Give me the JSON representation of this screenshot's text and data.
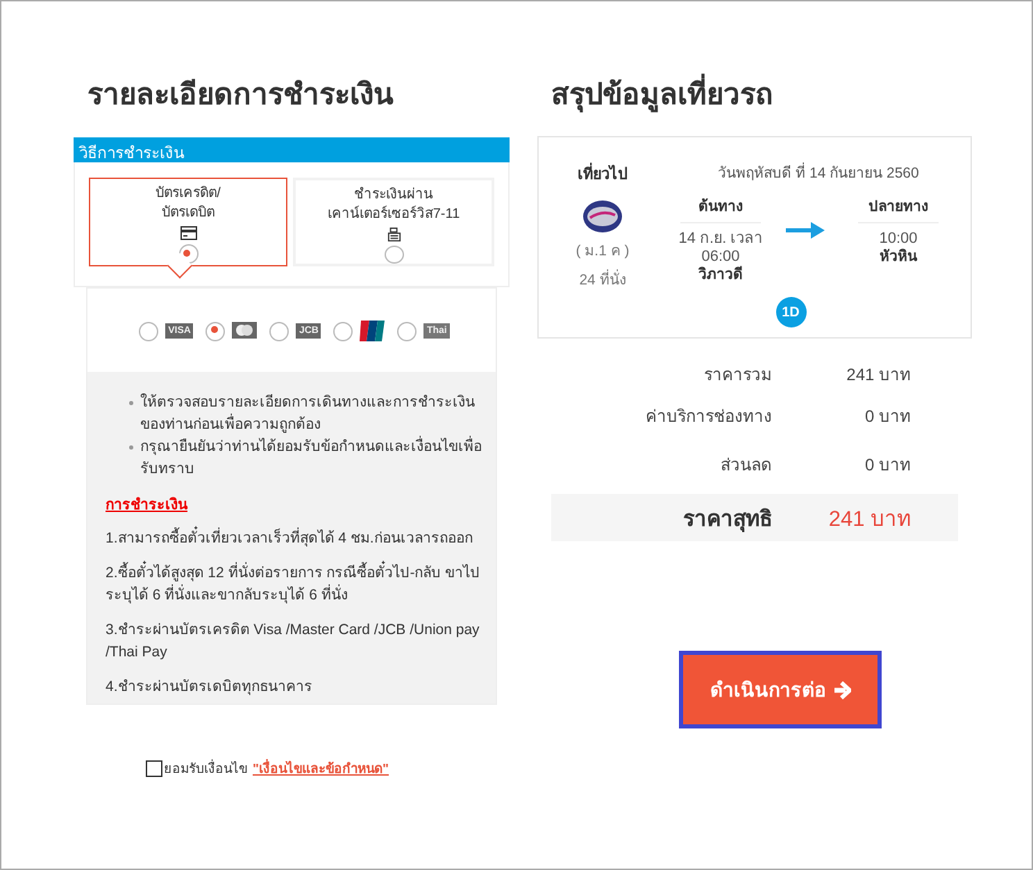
{
  "payment": {
    "title": "รายละเอียดการชำระเงิน",
    "section_title": "วิธีการชำระเงิน",
    "methods": [
      {
        "kind": "card",
        "label": "บัตรเครดิต/\nบัตรเดบิต",
        "selected": true
      },
      {
        "kind": "counter",
        "label": "ชำระเงินผ่าน\nเคาน์เตอร์เซอร์วิส7-11",
        "selected": false
      }
    ],
    "brands": [
      {
        "kind": "visa",
        "label": "VISA",
        "selected": false
      },
      {
        "kind": "mastercard",
        "selected": true
      },
      {
        "kind": "jcb",
        "label": "JCB",
        "selected": false
      },
      {
        "kind": "unionpay",
        "selected": false
      },
      {
        "kind": "thaipay",
        "label": "Thai",
        "selected": false
      }
    ],
    "notes": [
      "ให้ตรวจสอบรายละเอียดการเดินทางและการชำระเงินของท่านก่อนเพื่อความถูกต้อง",
      "กรุณายืนยันว่าท่านได้ยอมรับข้อกำหนดและเงื่อนไขเพื่อรับทราบ"
    ],
    "rules_title": "การชำระเงิน",
    "rules": [
      "1.สามารถซื้อตั๋วเที่ยวเวลาเร็วที่สุดได้ 4 ชม.ก่อนเวลารถออก",
      "2.ซื้อตั๋วได้สูงสุด 12 ที่นั่งต่อรายการ กรณีซื้อตั๋วไป-กลับ ขาไประบุได้ 6 ที่นั่งและขากลับระบุได้ 6 ที่นั่ง",
      "3.ชำระผ่านบัตรเครดิต Visa /Master Card /JCB /Union pay /Thai Pay",
      "4.ชำระผ่านบัตรเดบิตทุกธนาคาร"
    ],
    "agree": {
      "checked": false,
      "text": "ยอมรับเงื่อนไข",
      "link": "\"เงื่อนไขและข้อกำหนด\""
    }
  },
  "summary": {
    "title": "สรุปข้อมูลเที่ยวรถ",
    "trip": {
      "direction": "เที่ยวไป",
      "date": "วันพฤหัสบดี ที่ 14 กันยายน 2560",
      "bus_class": "( ม.1 ค )",
      "seats": "24 ที่นั่ง",
      "origin_label": "ต้นทาง",
      "origin_time": "14 ก.ย. เวลา\n06:00",
      "origin_place": "วิภาวดี",
      "dest_label": "ปลายทาง",
      "dest_time": "10:00",
      "dest_place": "หัวหิน",
      "badge": "1D"
    },
    "prices": [
      {
        "label": "ราคารวม",
        "value": "241 บาท"
      },
      {
        "label": "ค่าบริการช่องทาง",
        "value": "0 บาท"
      },
      {
        "label": "ส่วนลด",
        "value": "0 บาท"
      }
    ],
    "total": {
      "label": "ราคาสุทธิ",
      "value": "241 บาท"
    },
    "continue_button": "ดำเนินการต่อ"
  }
}
